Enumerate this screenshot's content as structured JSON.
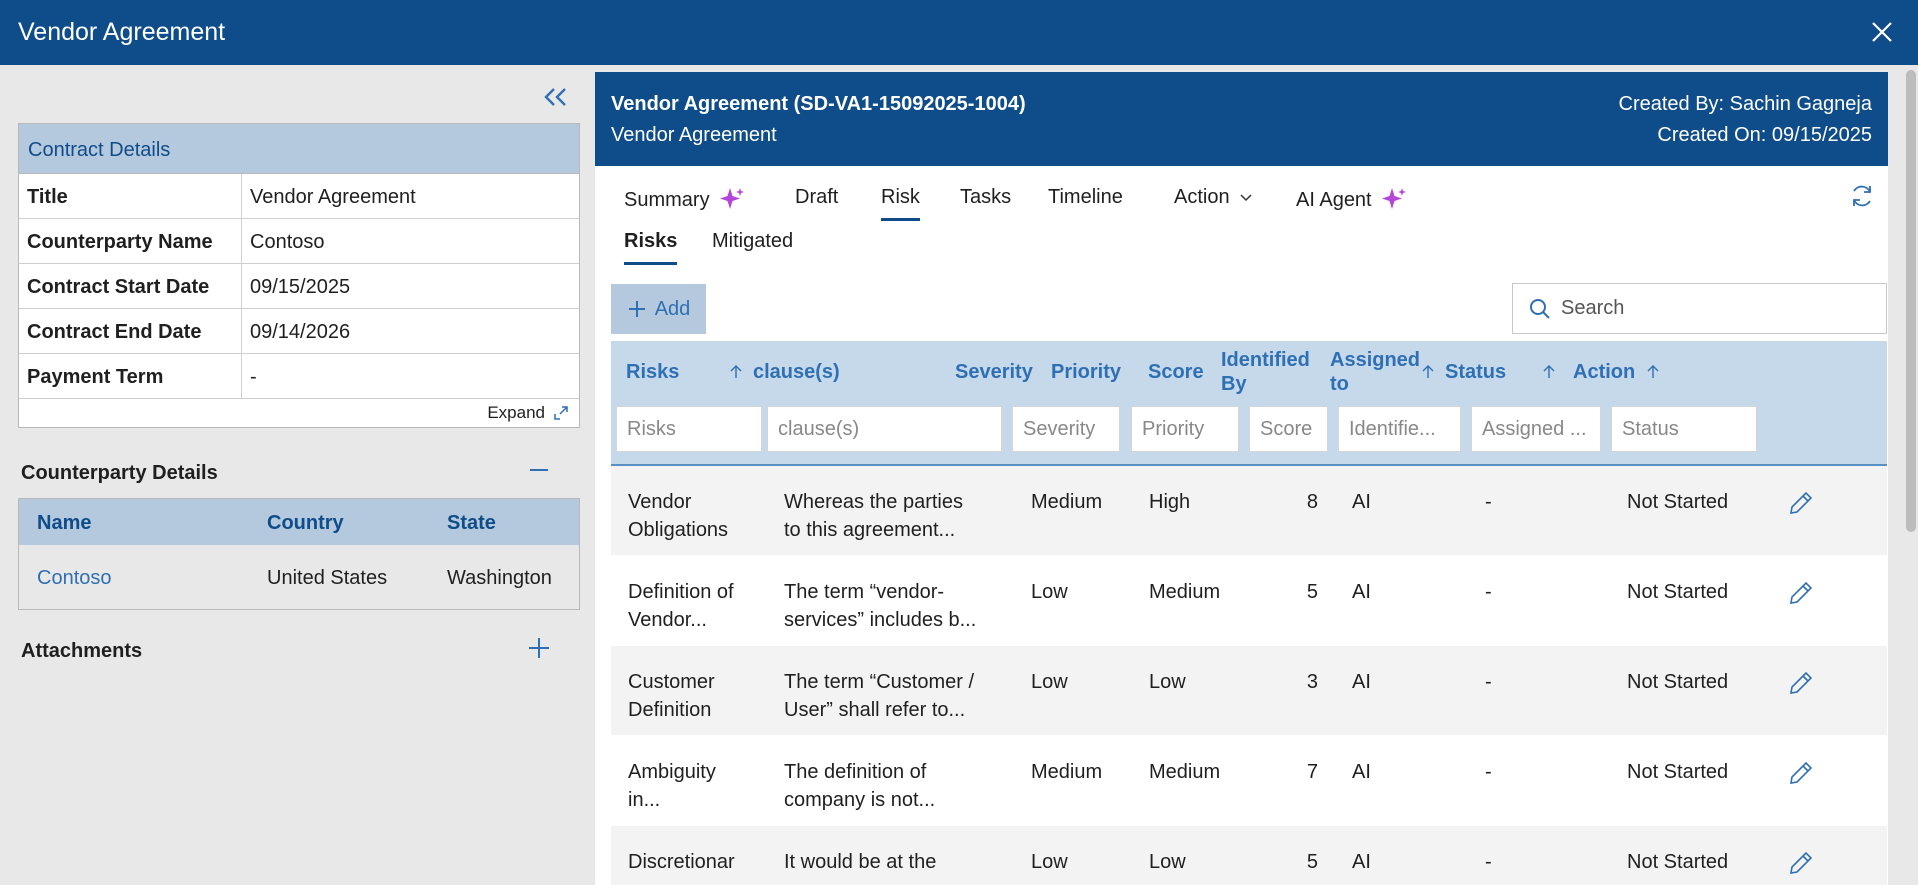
{
  "window": {
    "title": "Vendor Agreement",
    "close_icon": "close-icon"
  },
  "contract_details": {
    "heading": "Contract Details",
    "rows": [
      {
        "label": "Title",
        "value": "Vendor Agreement"
      },
      {
        "label": "Counterparty Name",
        "value": "Contoso"
      },
      {
        "label": "Contract Start Date",
        "value": "09/15/2025"
      },
      {
        "label": "Contract End Date",
        "value": "09/14/2026"
      },
      {
        "label": "Payment Term",
        "value": "-"
      }
    ],
    "expand_label": "Expand"
  },
  "counterparty": {
    "heading": "Counterparty Details",
    "columns": [
      "Name",
      "Country",
      "State"
    ],
    "row": {
      "name": "Contoso",
      "country": "United States",
      "state": "Washington"
    }
  },
  "attachments": {
    "heading": "Attachments"
  },
  "header": {
    "title": "Vendor Agreement (SD-VA1-15092025-1004)",
    "subtitle": "Vendor Agreement",
    "created_by": "Created By: Sachin Gagneja",
    "created_on": "Created On: 09/15/2025"
  },
  "tabs": [
    {
      "label": "Summary"
    },
    {
      "label": "Draft"
    },
    {
      "label": "Risk"
    },
    {
      "label": "Tasks"
    },
    {
      "label": "Timeline"
    },
    {
      "label": "Action"
    },
    {
      "label": "AI Agent"
    }
  ],
  "active_tab": "Risk",
  "subtabs": [
    {
      "label": "Risks"
    },
    {
      "label": "Mitigated"
    }
  ],
  "toolbar": {
    "add_label": "Add",
    "search_placeholder": "Search"
  },
  "grid": {
    "columns": [
      "Risks",
      "clause(s)",
      "Severity",
      "Priority",
      "Score",
      "Identified By",
      "Assigned to",
      "Status",
      "Action"
    ],
    "filters": [
      "Risks",
      "clause(s)",
      "Severity",
      "Priority",
      "Score",
      "Identifie...",
      "Assigned ...",
      "Status"
    ],
    "rows": [
      {
        "risk": "Vendor Obligations",
        "clause": "Whereas the parties to this agreement...",
        "severity": "Medium",
        "priority": "High",
        "score": "8",
        "identified_by": "AI",
        "assigned_to": "-",
        "status": "Not Started"
      },
      {
        "risk": "Definition of Vendor...",
        "clause": "The term “vendor-services” includes b...",
        "severity": "Low",
        "priority": "Medium",
        "score": "5",
        "identified_by": "AI",
        "assigned_to": "-",
        "status": "Not Started"
      },
      {
        "risk": "Customer Definition",
        "clause": "The term “Customer / User” shall refer to...",
        "severity": "Low",
        "priority": "Low",
        "score": "3",
        "identified_by": "AI",
        "assigned_to": "-",
        "status": "Not Started"
      },
      {
        "risk": "Ambiguity in...",
        "clause": "The definition of company is not...",
        "severity": "Medium",
        "priority": "Medium",
        "score": "7",
        "identified_by": "AI",
        "assigned_to": "-",
        "status": "Not Started"
      },
      {
        "risk": "Discretionar",
        "clause": "It would be at the",
        "severity": "Low",
        "priority": "Low",
        "score": "5",
        "identified_by": "AI",
        "assigned_to": "-",
        "status": "Not Started"
      }
    ]
  },
  "colors": {
    "brand": "#0f4c8a",
    "header_fill": "#b4c9dd",
    "link": "#2f6fb3",
    "sparkle": "#b545d8"
  }
}
